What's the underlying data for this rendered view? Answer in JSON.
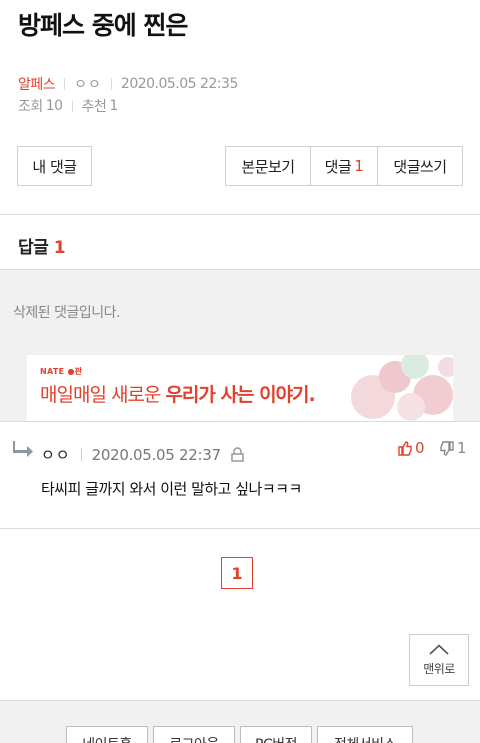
{
  "post": {
    "title": "방페스 중에 찐은",
    "category": "알페스",
    "author": "ㅇㅇ",
    "datetime": "2020.05.05 22:35",
    "views_label": "조회",
    "views": "10",
    "recommend_label": "추천",
    "recommend": "1"
  },
  "buttons": {
    "my_comments": "내 댓글",
    "view_post": "본문보기",
    "comments_label": "댓글",
    "comments_count": "1",
    "write_comment": "댓글쓰기"
  },
  "replies": {
    "label": "답글",
    "count": "1"
  },
  "deleted_comment": "삭제된 댓글입니다.",
  "ad": {
    "logo": "NATE ●판",
    "text_normal": "매일매일 새로운 ",
    "text_bold": "우리가 사는 이야기."
  },
  "comment": {
    "author": "ㅇㅇ",
    "datetime": "2020.05.05 22:37",
    "text": "타씨피 글까지 와서 이런 말하고 싶나ㅋㅋㅋ",
    "likes": "0",
    "dislikes": "1"
  },
  "pagination": {
    "current": "1"
  },
  "to_top": "맨위로",
  "footer": {
    "links": [
      "네이트홈",
      "로그아웃",
      "PC버전",
      "전체서비스"
    ]
  },
  "colors": {
    "accent": "#e2422d",
    "section_bg": "#f1f1f1"
  }
}
